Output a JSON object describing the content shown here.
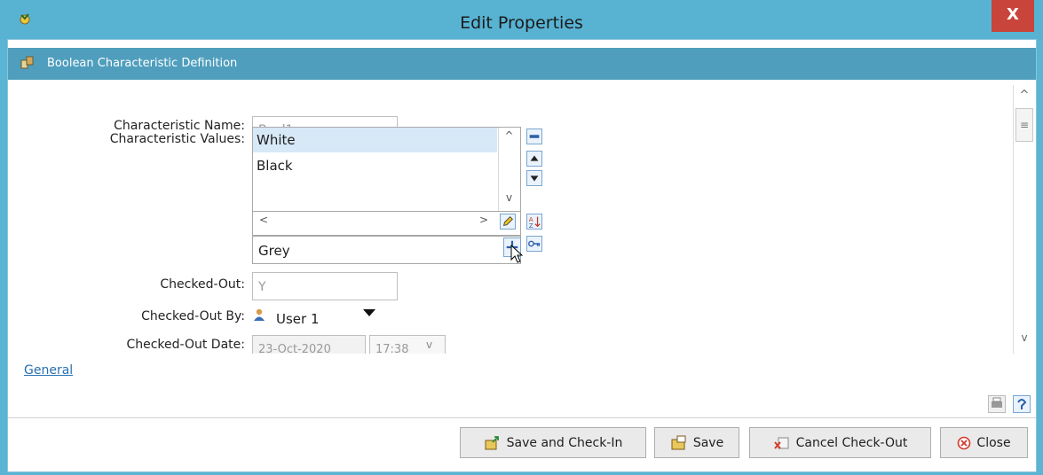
{
  "window": {
    "title": "Edit Properties",
    "close_glyph": "X"
  },
  "section": {
    "title": "Boolean Characteristic Definition"
  },
  "form": {
    "name_label": "Characteristic Name:",
    "name_value": "Bool1",
    "values_label": "Characteristic Values:",
    "values": [
      "White",
      "Black"
    ],
    "new_value": "Grey",
    "checked_out_label": "Checked-Out:",
    "checked_out_value": "Y",
    "checked_out_by_label": "Checked-Out By:",
    "checked_out_by_value": "User 1",
    "checked_out_date_label": "Checked-Out Date:",
    "checked_out_date_value": "23-Oct-2020",
    "checked_out_time_value": "17:38"
  },
  "link_general": "General",
  "buttons": {
    "save_checkin": "Save and Check-In",
    "save": "Save",
    "cancel_checkout": "Cancel Check-Out",
    "close": "Close"
  },
  "colors": {
    "titlebar": "#58b3d3",
    "section_header": "#4f9ebd",
    "close_button": "#c9443a",
    "selected_item": "#d7e8f7"
  }
}
